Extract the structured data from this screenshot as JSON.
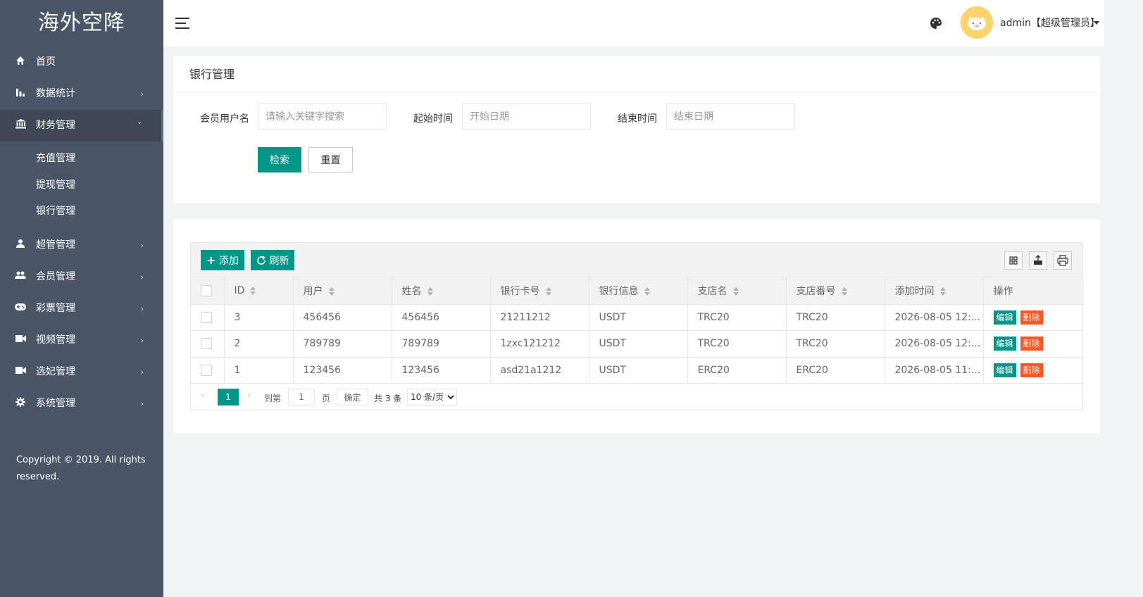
{
  "app": {
    "logo": "海外空降"
  },
  "sidebar": {
    "items": [
      {
        "label": "首页",
        "icon": "home-icon"
      },
      {
        "label": "数据统计",
        "icon": "bar-chart-icon"
      },
      {
        "label": "财务管理",
        "icon": "bank-icon"
      },
      {
        "label": "超管管理",
        "icon": "user-icon"
      },
      {
        "label": "会员管理",
        "icon": "users-icon"
      },
      {
        "label": "彩票管理",
        "icon": "gamepad-icon"
      },
      {
        "label": "视频管理",
        "icon": "video-icon"
      },
      {
        "label": "选妃管理",
        "icon": "video-icon"
      },
      {
        "label": "系统管理",
        "icon": "gear-icon"
      }
    ],
    "sub_items": [
      "充值管理",
      "提现管理",
      "银行管理"
    ],
    "copyright": "Copyright © 2019. All rights reserved."
  },
  "header": {
    "user": "admin【超级管理员】"
  },
  "search": {
    "title": "银行管理",
    "username_label": "会员用户名",
    "username_placeholder": "请输入关键字搜索",
    "start_label": "起始时间",
    "start_placeholder": "开始日期",
    "end_label": "结束时间",
    "end_placeholder": "结束日期",
    "search_btn": "检索",
    "reset_btn": "重置"
  },
  "toolbar": {
    "add": "添加",
    "refresh": "刷新"
  },
  "table": {
    "columns": [
      "ID",
      "用户",
      "姓名",
      "银行卡号",
      "银行信息",
      "支店名",
      "支店番号",
      "添加时间",
      "操作"
    ],
    "rows": [
      {
        "id": "3",
        "user": "456456",
        "name": "456456",
        "card": "21211212",
        "bank": "USDT",
        "branch": "TRC20",
        "branch_no": "TRC20",
        "time": "2026-08-05 12:..."
      },
      {
        "id": "2",
        "user": "789789",
        "name": "789789",
        "card": "1zxc121212",
        "bank": "USDT",
        "branch": "TRC20",
        "branch_no": "TRC20",
        "time": "2026-08-05 12:..."
      },
      {
        "id": "1",
        "user": "123456",
        "name": "123456",
        "card": "asd21a1212",
        "bank": "USDT",
        "branch": "ERC20",
        "branch_no": "ERC20",
        "time": "2026-08-05 11:..."
      }
    ],
    "edit": "编辑",
    "delete": "删除"
  },
  "pager": {
    "current": "1",
    "goto_label": "到第",
    "page_value": "1",
    "page_unit": "页",
    "confirm": "确定",
    "total": "共 3 条",
    "page_size": "10 条/页"
  },
  "colors": {
    "sidebar": "#4a5568",
    "primary": "#009688",
    "danger": "#ff5722"
  }
}
